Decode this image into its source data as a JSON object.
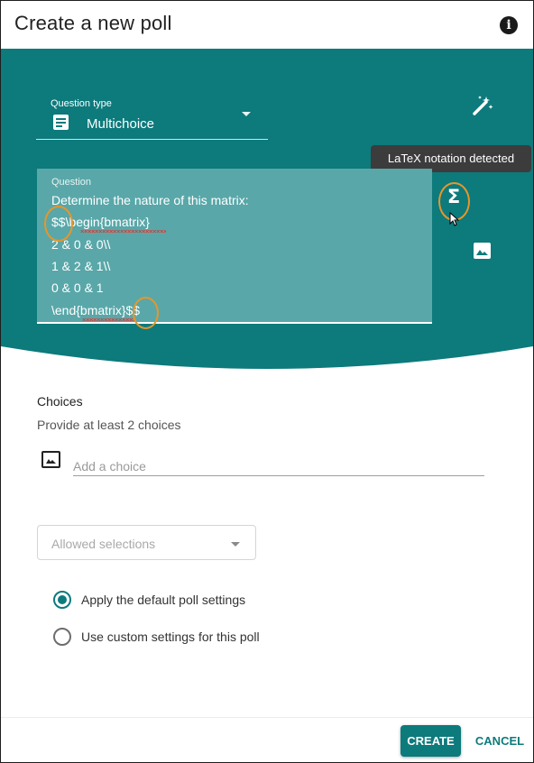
{
  "dialog": {
    "title": "Create a new poll",
    "info_icon": "info-icon"
  },
  "question_type": {
    "label": "Question type",
    "value": "Multichoice",
    "icon": "document-icon"
  },
  "tooltip": {
    "text": "LaTeX notation detected"
  },
  "question": {
    "label": "Question",
    "lines": [
      "Determine the nature of this matrix:",
      "$$\\begin{bmatrix}",
      "2 & 0 & 0\\\\",
      "1 & 2 & 1\\\\",
      "0 & 0 & 1",
      "\\end{bmatrix}$$"
    ]
  },
  "toolbar": {
    "wand_icon": "magic-wand-icon",
    "sigma_icon": "sigma-icon",
    "image_icon": "image-icon"
  },
  "choices": {
    "heading": "Choices",
    "hint": "Provide at least 2 choices",
    "input_placeholder": "Add a choice",
    "input_value": ""
  },
  "allowed_selections": {
    "placeholder": "Allowed selections"
  },
  "settings": {
    "options": [
      {
        "label": "Apply the default poll settings",
        "selected": true
      },
      {
        "label": "Use custom settings for this poll",
        "selected": false
      }
    ]
  },
  "footer": {
    "create_label": "CREATE",
    "cancel_label": "CANCEL"
  },
  "colors": {
    "teal": "#0d7a7c",
    "teal_light": "#59a7a9",
    "highlight_ring": "#e7962a",
    "tooltip_bg": "#3c3c3c"
  }
}
